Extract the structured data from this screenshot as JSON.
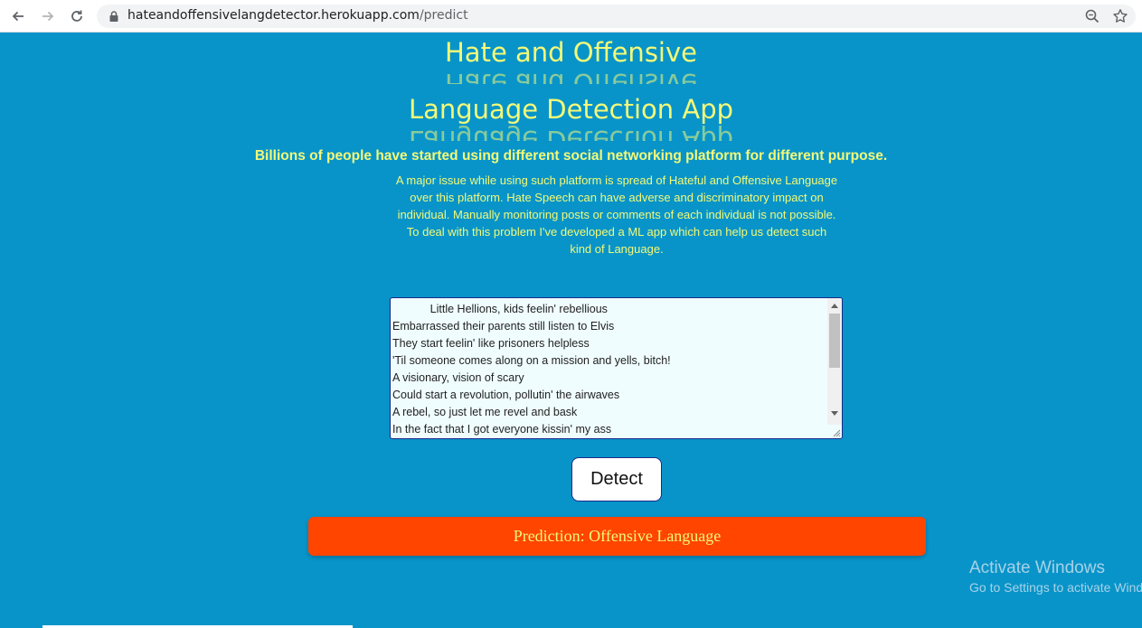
{
  "browser": {
    "url_host": "hateandoffensivelangdetector.herokuapp.com",
    "url_path": "/predict",
    "icons": [
      "back-icon",
      "forward-icon",
      "reload-icon",
      "lock-icon",
      "zoom-icon",
      "star-icon"
    ]
  },
  "page": {
    "title_line1": "Hate and Offensive",
    "title_line2": "Language Detection App",
    "subtitle": "Billions of people have started using different social networking platform for different purpose.",
    "description": "A major issue while using such platform is spread of Hateful and Offensive Language over this platform. Hate Speech can have adverse and discriminatory impact on individual. Manually monitoring posts or comments of each individual is not possible. To deal with this problem I've developed a ML app which can help us detect such kind of Language.",
    "input_text": "            Little Hellions, kids feelin' rebellious\nEmbarrassed their parents still listen to Elvis\nThey start feelin' like prisoners helpless\n'Til someone comes along on a mission and yells, bitch!\nA visionary, vision of scary\nCould start a revolution, pollutin' the airwaves\nA rebel, so just let me revel and bask\nIn the fact that I got everyone kissin' my ass",
    "detect_label": "Detect",
    "prediction": "Prediction: Offensive Language"
  },
  "os_watermark": {
    "line1": "Activate Windows",
    "line2": "Go to Settings to activate Windows."
  },
  "colors": {
    "background": "#0894c9",
    "title_text": "#f3f978",
    "prediction_bg": "#ff4500"
  }
}
